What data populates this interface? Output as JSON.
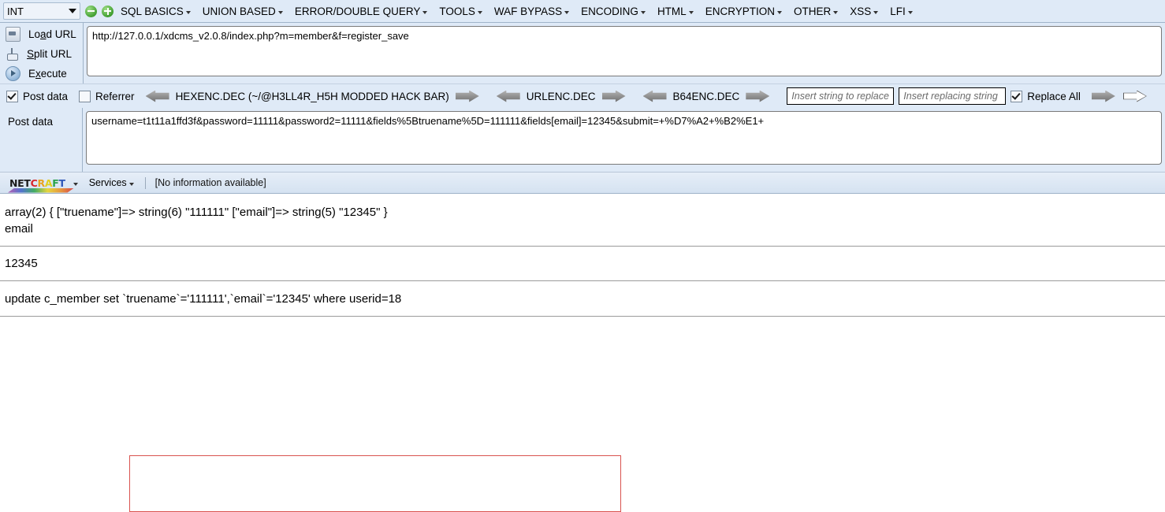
{
  "hackbar": {
    "type_selector": {
      "value": "INT",
      "icon": "chevron-down-icon"
    },
    "add_label": "+",
    "remove_label": "-",
    "menu": [
      {
        "label": "SQL BASICS"
      },
      {
        "label": "UNION BASED"
      },
      {
        "label": "ERROR/DOUBLE QUERY"
      },
      {
        "label": "TOOLS"
      },
      {
        "label": "WAF BYPASS"
      },
      {
        "label": "ENCODING"
      },
      {
        "label": "HTML"
      },
      {
        "label": "ENCRYPTION"
      },
      {
        "label": "OTHER"
      },
      {
        "label": "XSS"
      },
      {
        "label": "LFI"
      }
    ],
    "actions": [
      {
        "label_before": "Lo",
        "accel": "a",
        "label_after": "d URL",
        "icon": "load-url-icon"
      },
      {
        "label_before": "",
        "accel": "S",
        "label_after": "plit URL",
        "icon": "split-url-icon"
      },
      {
        "label_before": "E",
        "accel": "x",
        "label_after": "ecute",
        "icon": "execute-icon"
      }
    ],
    "url_value": "http://127.0.0.1/xdcms_v2.0.8/index.php?m=member&f=register_save",
    "options": {
      "post_data_label": "Post data",
      "post_data_checked": true,
      "referrer_label": "Referrer",
      "referrer_checked": false,
      "replace_all_label": "Replace All",
      "replace_all_checked": true
    },
    "encoders": [
      {
        "label": "HEXENC.DEC (~/@H3LL4R_H5H MODDED HACK BAR)"
      },
      {
        "label": "URLENC.DEC"
      },
      {
        "label": "B64ENC.DEC"
      }
    ],
    "replace_fields": {
      "search_placeholder": "Insert string to replace",
      "search_value": "",
      "replace_placeholder": "Insert replacing string",
      "replace_value": ""
    },
    "post_data": {
      "label": "Post data",
      "value": "username=t1t11a1ffd3f&password=11111&password2=11111&fields%5Btruename%5D=111111&fields[email]=12345&submit=+%D7%A2+%B2%E1+"
    }
  },
  "netcraft": {
    "logo_text": "NETCRAFT",
    "logo_letters": [
      {
        "ch": "N",
        "color": "#1a1a1a"
      },
      {
        "ch": "E",
        "color": "#1a1a1a"
      },
      {
        "ch": "T",
        "color": "#1a1a1a"
      },
      {
        "ch": "C",
        "color": "#d8262a"
      },
      {
        "ch": "R",
        "color": "#e8a31f"
      },
      {
        "ch": "A",
        "color": "#e0cf1d"
      },
      {
        "ch": "F",
        "color": "#28a24a"
      },
      {
        "ch": "T",
        "color": "#2f57b8"
      }
    ],
    "services_label": "Services",
    "info_text": "[No information available]"
  },
  "page": {
    "line1": "array(2) { [\"truename\"]=> string(6) \"111111\" [\"email\"]=> string(5) \"12345\" }",
    "line2": "email",
    "line3": "12345",
    "line4": "update c_member set `truename`='111111',`email`='12345' where userid=18",
    "highlight_color": "#d9534f"
  }
}
